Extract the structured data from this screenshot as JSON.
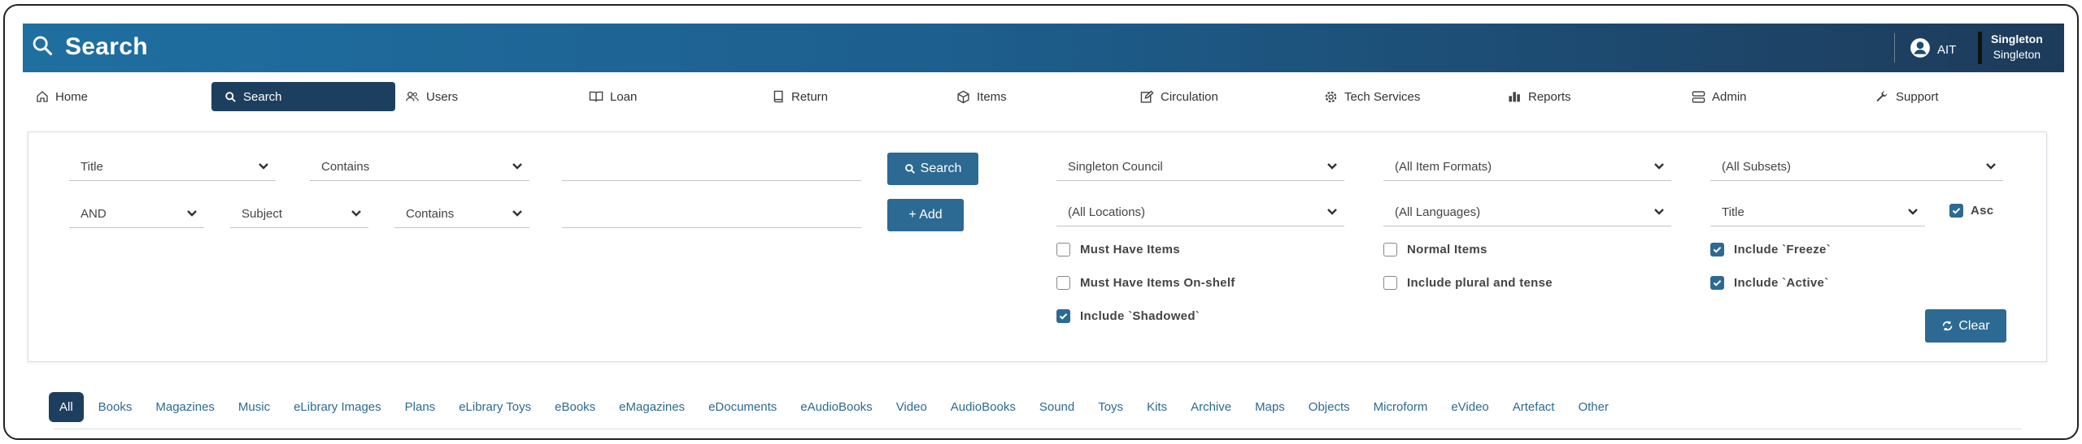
{
  "header": {
    "title": "Search",
    "user": "AIT",
    "branch_line1": "Singleton",
    "branch_line2": "Singleton"
  },
  "nav": {
    "items": [
      {
        "label": "Home",
        "icon": "home-icon"
      },
      {
        "label": "Search",
        "icon": "search-icon"
      },
      {
        "label": "Users",
        "icon": "users-icon"
      },
      {
        "label": "Loan",
        "icon": "book-icon"
      },
      {
        "label": "Return",
        "icon": "return-book-icon"
      },
      {
        "label": "Items",
        "icon": "box-icon"
      },
      {
        "label": "Circulation",
        "icon": "edit-icon"
      },
      {
        "label": "Tech Services",
        "icon": "gear-icon"
      },
      {
        "label": "Reports",
        "icon": "bar-chart-icon"
      },
      {
        "label": "Admin",
        "icon": "server-icon"
      },
      {
        "label": "Support",
        "icon": "wrench-icon"
      }
    ]
  },
  "query": {
    "row1": {
      "field": "Title",
      "operator": "Contains",
      "value": ""
    },
    "row2": {
      "bool": "AND",
      "field": "Subject",
      "operator": "Contains",
      "value": ""
    }
  },
  "buttons": {
    "search": "Search",
    "add": "+ Add",
    "clear": "Clear"
  },
  "filters": {
    "library": "Singleton Council",
    "item_formats": "(All Item Formats)",
    "subsets": "(All Subsets)",
    "locations": "(All Locations)",
    "languages": "(All Languages)",
    "sort": "Title",
    "asc": "Asc"
  },
  "checkboxes": {
    "must_have_items": {
      "label": "Must Have Items",
      "checked": false
    },
    "must_have_items_onshelf": {
      "label": "Must Have Items On-shelf",
      "checked": false
    },
    "include_shadowed": {
      "label": "Include `Shadowed`",
      "checked": true
    },
    "normal_items": {
      "label": "Normal Items",
      "checked": false
    },
    "include_plural": {
      "label": "Include plural and tense",
      "checked": false
    },
    "include_freeze": {
      "label": "Include `Freeze`",
      "checked": true
    },
    "include_active": {
      "label": "Include `Active`",
      "checked": true
    },
    "asc": {
      "checked": true
    }
  },
  "format_tabs": [
    "All",
    "Books",
    "Magazines",
    "Music",
    "eLibrary Images",
    "Plans",
    "eLibrary Toys",
    "eBooks",
    "eMagazines",
    "eDocuments",
    "eAudioBooks",
    "Video",
    "AudioBooks",
    "Sound",
    "Toys",
    "Kits",
    "Archive",
    "Maps",
    "Objects",
    "Microform",
    "eVideo",
    "Artefact",
    "Other"
  ],
  "colors": {
    "header_start": "#1f6fa1",
    "header_end": "#1d3b5a",
    "accent": "#2d6a93",
    "active_nav": "#1d3f5f"
  }
}
